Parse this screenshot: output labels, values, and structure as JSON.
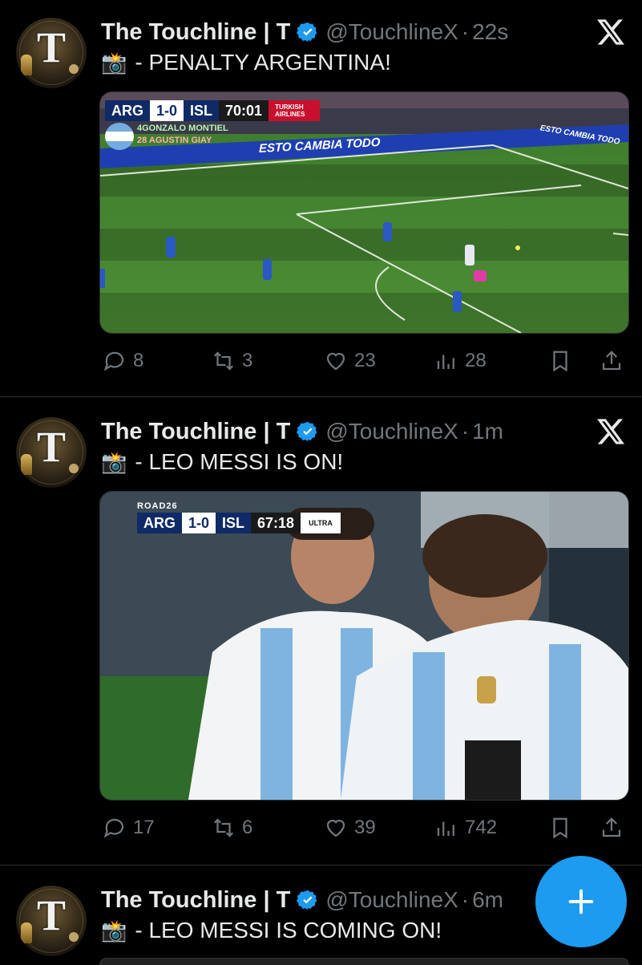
{
  "tweets": [
    {
      "author": "The Touchline | T",
      "handle": "@TouchlineX",
      "time": "22s",
      "text": "- PENALTY ARGENTINA!",
      "media": {
        "scoreboard": {
          "home": "ARG",
          "score": "1-0",
          "away": "ISL",
          "clock": "70:01"
        },
        "sponsor": "TURKISH AIRLINES",
        "sub_in": "4GONZALO MONTIEL",
        "sub_out": "28 AGUSTIN GIAY",
        "banner": "ESTO CAMBIA TODO",
        "banner_right": "ESTO CAMBIA TODO"
      },
      "stats": {
        "replies": "8",
        "reposts": "3",
        "likes": "23",
        "views": "28"
      }
    },
    {
      "author": "The Touchline | T",
      "handle": "@TouchlineX",
      "time": "1m",
      "text": "- LEO MESSI IS ON!",
      "media": {
        "top_bar": "ROAD26",
        "scoreboard": {
          "home": "ARG",
          "score": "1-0",
          "away": "ISL",
          "clock": "67:18"
        },
        "badge": "ULTRA"
      },
      "stats": {
        "replies": "17",
        "reposts": "6",
        "likes": "39",
        "views": "742"
      }
    },
    {
      "author": "The Touchline | T",
      "handle": "@TouchlineX",
      "time": "6m",
      "text": "- LEO MESSI IS COMING ON!"
    }
  ],
  "icons": {
    "verified": "verified-badge-icon",
    "more": "x-logo-icon",
    "reply": "reply-icon",
    "repost": "repost-icon",
    "like": "heart-icon",
    "views": "views-icon",
    "bookmark": "bookmark-icon",
    "share": "share-icon",
    "compose": "plus-icon",
    "camera": "camera-flash-icon"
  },
  "colors": {
    "background": "#000000",
    "text": "#e7e9ea",
    "muted": "#71767b",
    "accent": "#1d9bf0",
    "divider": "#2f3336"
  }
}
